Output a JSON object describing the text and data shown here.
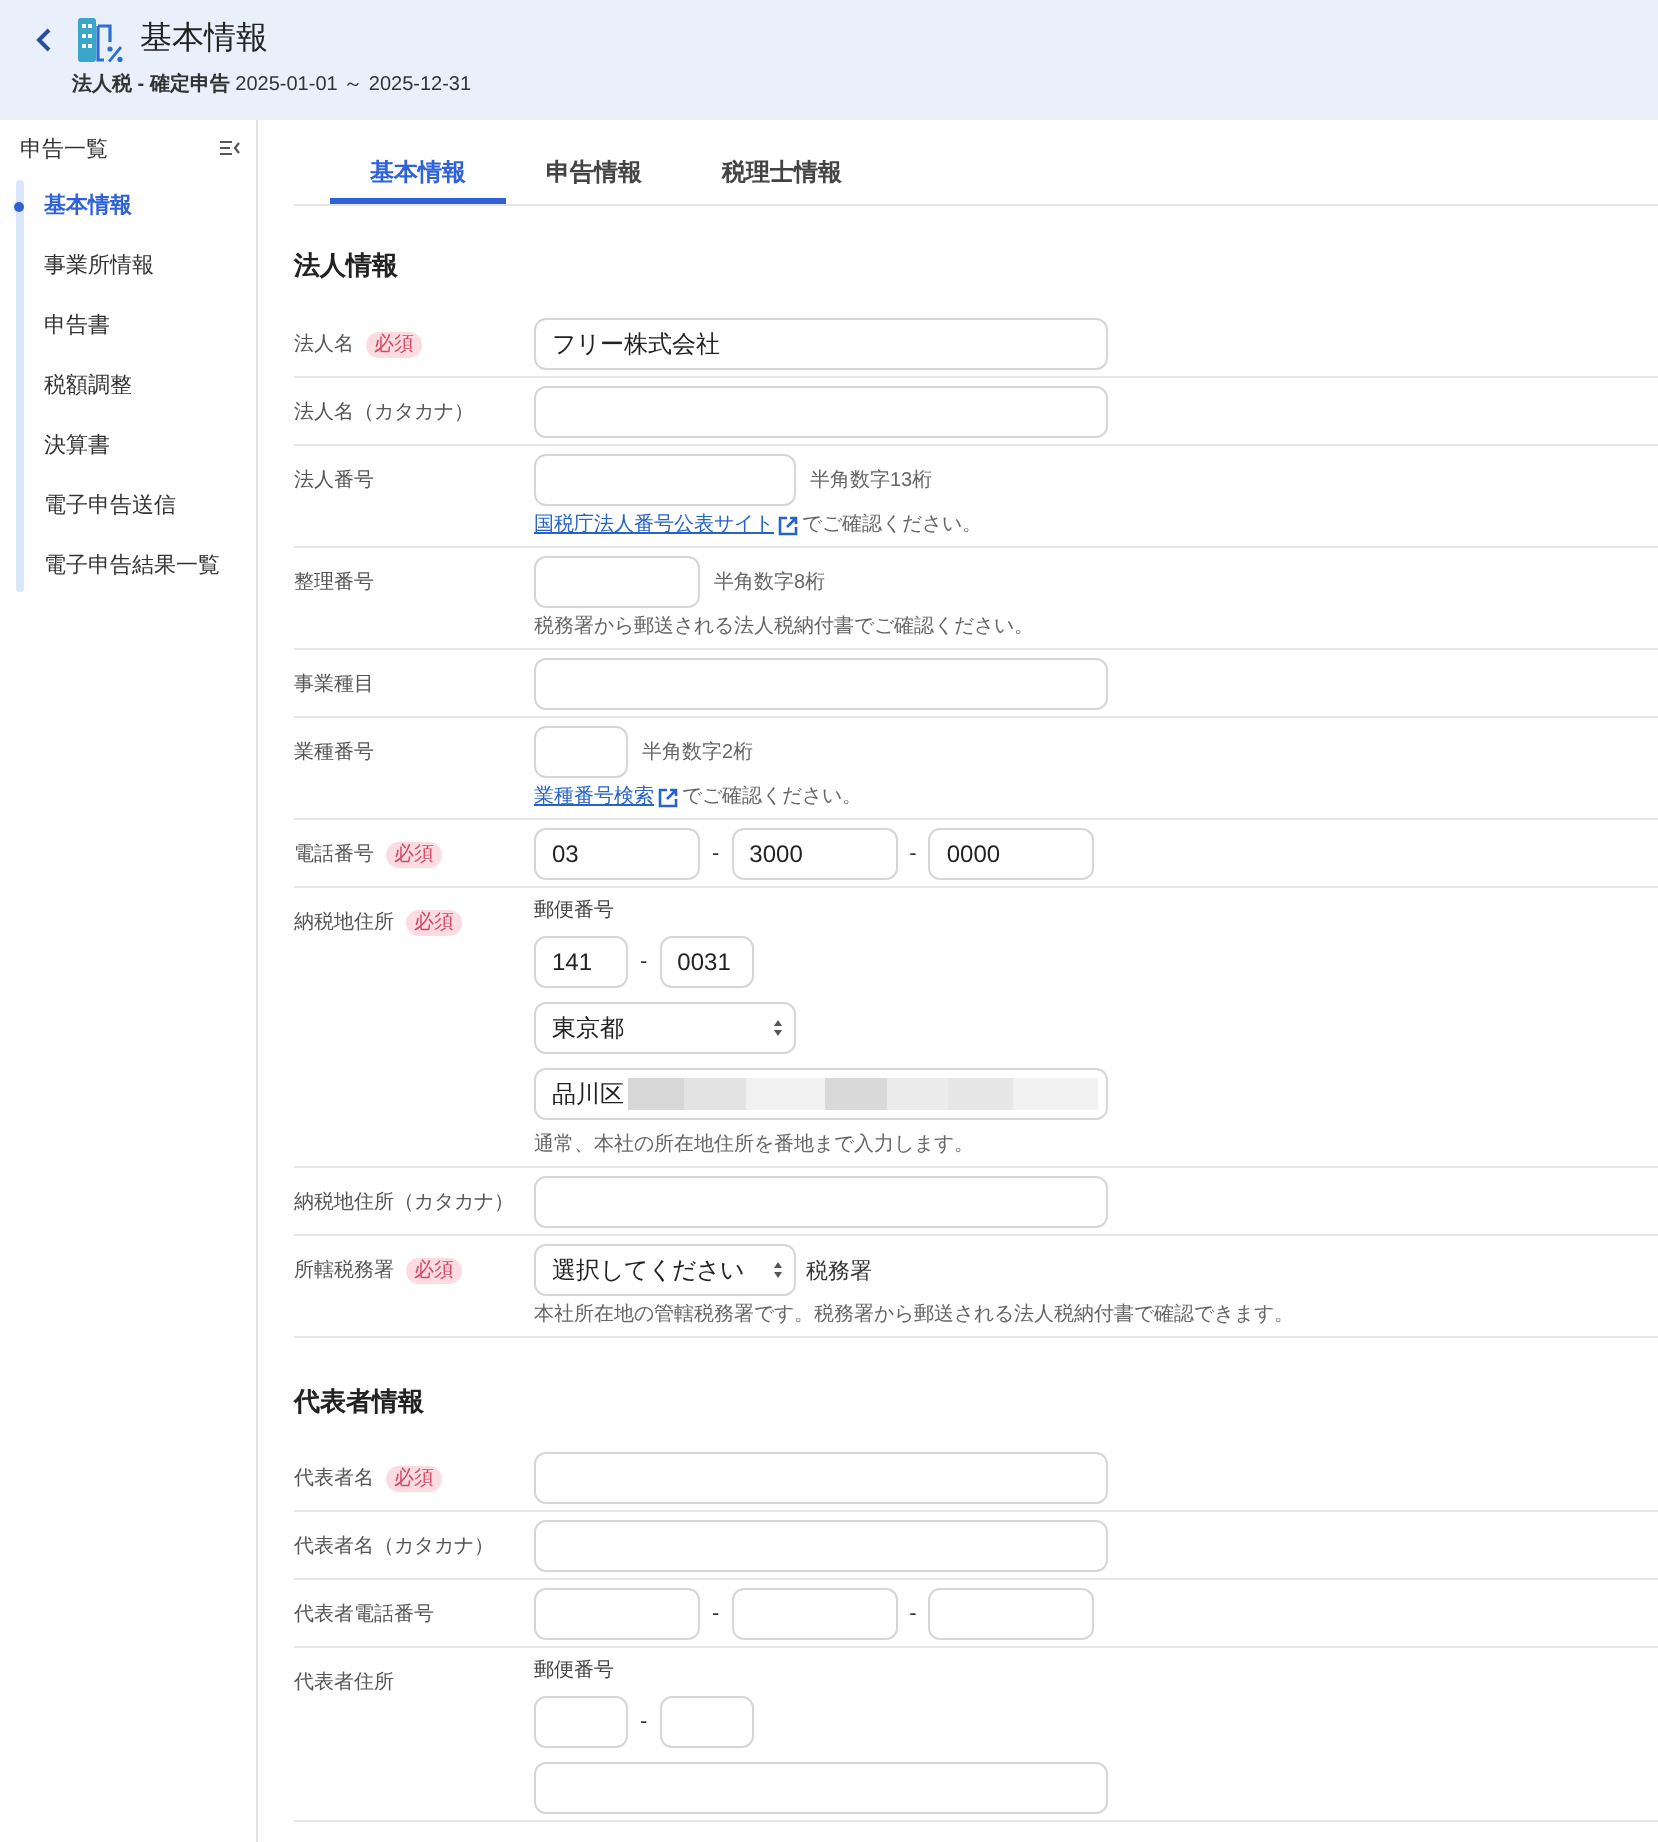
{
  "header": {
    "title": "基本情報",
    "subtitle": "**法人税 - 確定申告** 2025-01-01 ～ 2025-12-31"
  },
  "sidebar": {
    "heading": "申告一覧",
    "items": [
      {
        "label": "基本情報",
        "selected": true
      },
      {
        "label": "事業所情報",
        "selected": false
      },
      {
        "label": "申告書",
        "selected": false
      },
      {
        "label": "税額調整",
        "selected": false
      },
      {
        "label": "決算書",
        "selected": false
      },
      {
        "label": "電子申告送信",
        "selected": false
      },
      {
        "label": "電子申告結果一覧",
        "selected": false
      }
    ]
  },
  "tabs": [
    {
      "label": "基本情報",
      "selected": true
    },
    {
      "label": "申告情報",
      "selected": false
    },
    {
      "label": "税理士情報",
      "selected": false
    }
  ],
  "sections": [
    {
      "title": "法人情報",
      "rows": [
        {
          "kind": "text",
          "label": "法人名",
          "badge": "必須",
          "value": "フリー株式会社"
        },
        {
          "kind": "text",
          "label": "法人名（カタカナ）"
        },
        {
          "kind": "corpnumber",
          "label": "法人番号",
          "hint": "半角数字13桁",
          "link": "国税庁法人番号公表サイト",
          "note": "でご確認ください。"
        },
        {
          "kind": "refnumber",
          "label": "整理番号",
          "hint": "半角数字8桁",
          "note": "税務署から郵送される法人税納付書でご確認ください。"
        },
        {
          "kind": "text",
          "label": "事業種目"
        },
        {
          "kind": "code",
          "label": "業種番号",
          "hint": "半角数字2桁",
          "link": "業種番号検索",
          "note": "でご確認ください。"
        },
        {
          "kind": "phone",
          "label": "電話番号",
          "badge": "必須",
          "values": [
            "03",
            "3000",
            "0000"
          ],
          "separators": [
            "-",
            "-"
          ]
        },
        {
          "kind": "address",
          "label": "納税地住所",
          "badge": "必須",
          "postal_label": "郵便番号",
          "postal": [
            "141",
            "0031"
          ],
          "postal_separator": "-",
          "prefecture": "東京都",
          "street": "品川区",
          "redacted": true,
          "note": "通常、本社の所在地住所を番地まで入力します。"
        },
        {
          "kind": "text",
          "label": "納税地住所（カタカナ）"
        },
        {
          "kind": "select",
          "label": "所轄税務署",
          "badge": "必須",
          "value": "選択してください",
          "suffix": "税務署",
          "note": "本社所在地の管轄税務署です。税務署から郵送される法人税納付書で確認できます。"
        }
      ]
    },
    {
      "title": "代表者情報",
      "rows": [
        {
          "kind": "text",
          "label": "代表者名",
          "badge": "必須"
        },
        {
          "kind": "text",
          "label": "代表者名（カタカナ）"
        },
        {
          "kind": "phone",
          "label": "代表者電話番号",
          "separators": [
            "-",
            "-"
          ]
        },
        {
          "kind": "address",
          "label": "代表者住所",
          "postal_label": "郵便番号",
          "postal_separator": "-"
        }
      ]
    }
  ]
}
